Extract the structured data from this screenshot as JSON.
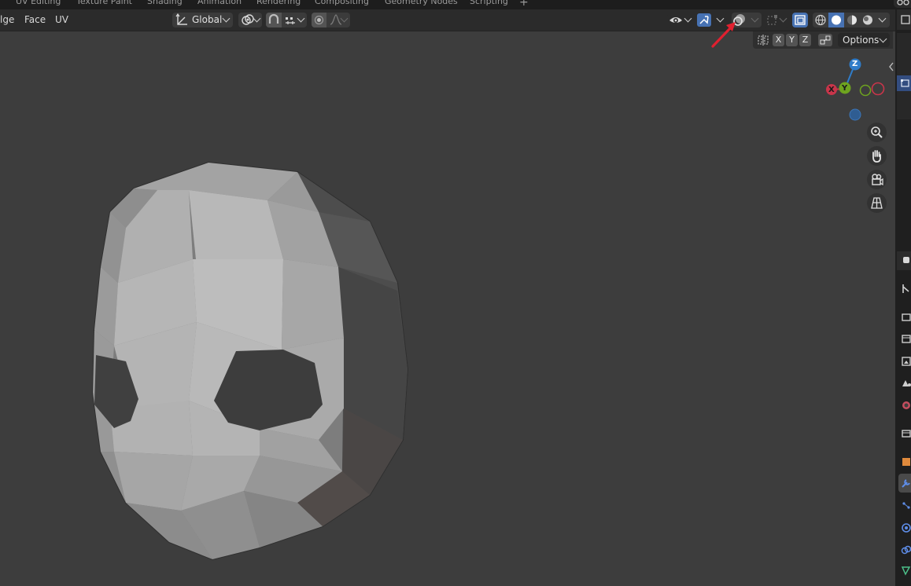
{
  "workspace_tabs": [
    "UV Editing",
    "Texture Paint",
    "Shading",
    "Animation",
    "Rendering",
    "Compositing",
    "Geometry Nodes",
    "Scripting"
  ],
  "add_workspace": "+",
  "header_menu": [
    "lge",
    "Face",
    "UV"
  ],
  "transform_orientation": "Global",
  "options_label": "Options",
  "axis_buttons": [
    "X",
    "Y",
    "Z"
  ],
  "gizmo": {
    "x": "X",
    "y": "Y",
    "z": "Z",
    "x_color": "#c8354a",
    "y_color": "#6ea41f",
    "z_color": "#2f7cc9"
  },
  "accent_color": "#4772b3",
  "annotation_color": "#e0202f",
  "icons": {
    "orientation": "transform-orientation-icon",
    "pivot": "pivot-point-icon",
    "snap": "snap-icon",
    "proportional": "proportional-editing-icon",
    "visibility": "object-visibility-icon",
    "gizmos": "viewport-gizmos-icon",
    "overlays": "overlays-icon",
    "xray": "xray-toggle-icon",
    "shading": [
      "wireframe-shading-icon",
      "solid-shading-icon",
      "material-preview-icon",
      "rendered-shading-icon"
    ],
    "nav": [
      "zoom-icon",
      "pan-hand-icon",
      "camera-view-icon",
      "perspective-grid-icon"
    ]
  }
}
